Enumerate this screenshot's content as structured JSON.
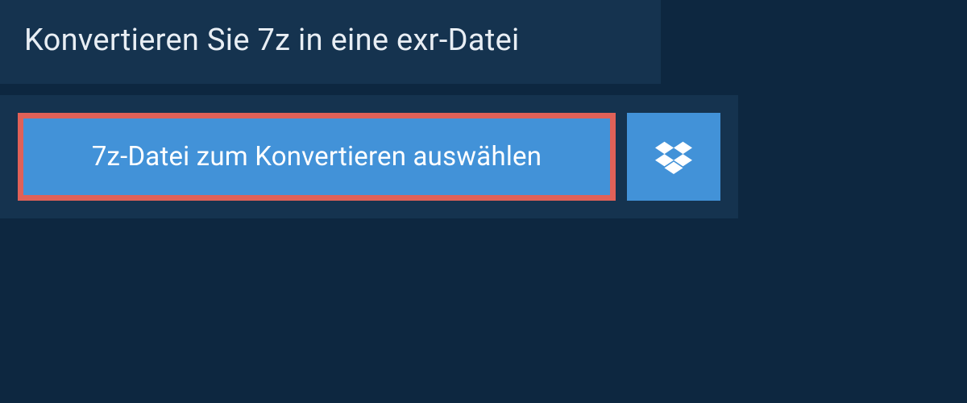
{
  "header": {
    "title": "Konvertieren Sie 7z in eine exr-Datei"
  },
  "upload": {
    "select_file_label": "7z-Datei zum Konvertieren auswählen",
    "dropbox_icon": "dropbox-icon"
  },
  "colors": {
    "page_bg": "#0d2740",
    "panel_bg": "#15334f",
    "button_bg": "#4292d8",
    "highlight_border": "#e06158",
    "text_light": "#e8eef4",
    "text_white": "#ffffff"
  }
}
